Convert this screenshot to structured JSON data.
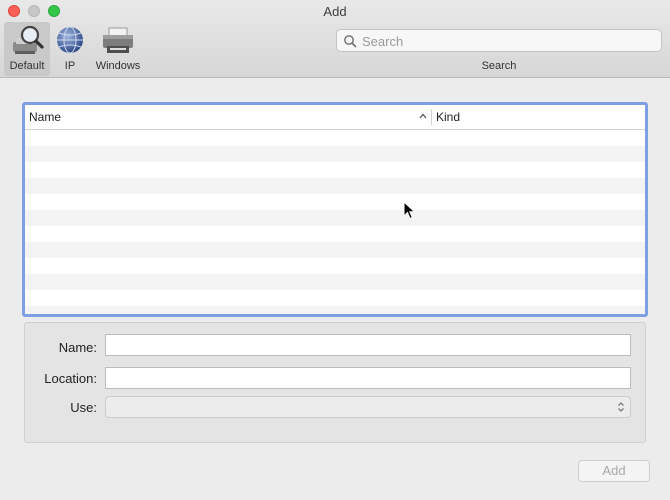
{
  "window": {
    "title": "Add"
  },
  "toolbar": {
    "tools": [
      {
        "label": "Default",
        "icon": "magnifier-printer-icon",
        "selected": true
      },
      {
        "label": "IP",
        "icon": "globe-icon"
      },
      {
        "label": "Windows",
        "icon": "printer-icon"
      }
    ],
    "search": {
      "placeholder": "Search",
      "value": "",
      "label": "Search"
    }
  },
  "table": {
    "columns": [
      {
        "label": "Name",
        "sort": "ascending"
      },
      {
        "label": "Kind"
      }
    ],
    "rows": []
  },
  "form": {
    "name_label": "Name:",
    "name_value": "",
    "location_label": "Location:",
    "location_value": "",
    "use_label": "Use:",
    "use_value": ""
  },
  "buttons": {
    "add_label": "Add"
  },
  "colors": {
    "focus_ring": "#7e9fe3",
    "close": "#fd5f57",
    "zoom": "#34c748"
  }
}
